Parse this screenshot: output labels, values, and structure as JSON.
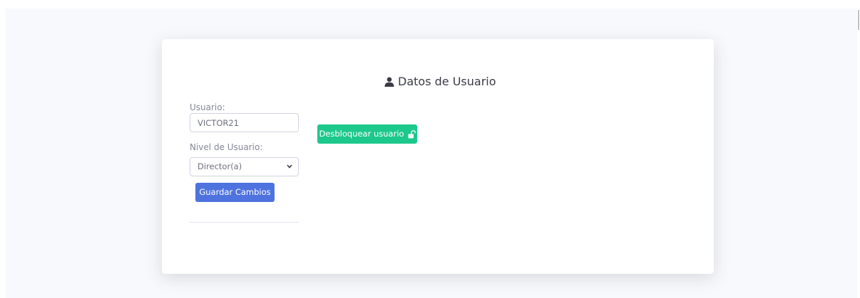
{
  "card": {
    "title": "Datos de Usuario",
    "title_icon": "user-icon"
  },
  "form": {
    "username_label": "Usuario:",
    "username_value": "VICTOR21",
    "level_label": "Nivel de Usuario:",
    "level_selected": "Director(a)",
    "save_label": "Guardar Cambios"
  },
  "actions": {
    "unlock_label": "Desbloquear usuario",
    "unlock_icon": "unlock-icon"
  },
  "colors": {
    "primary": "#4e73df",
    "success": "#1cc88a",
    "background": "#f8f9fc"
  }
}
